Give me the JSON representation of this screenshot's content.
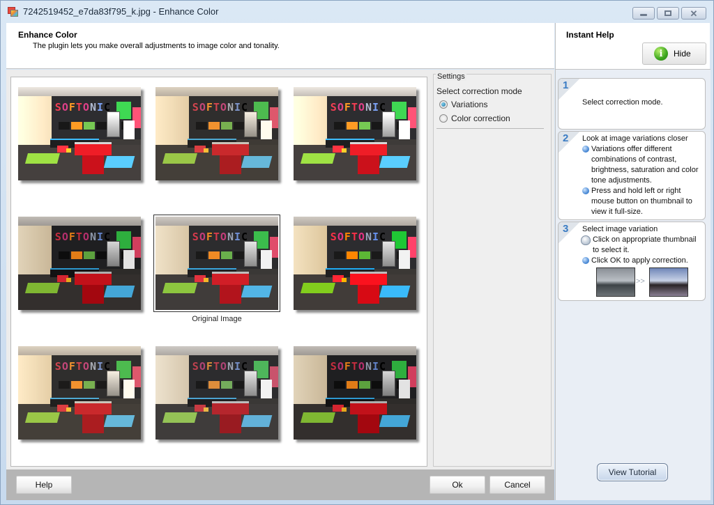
{
  "window": {
    "title": "7242519452_e7da83f795_k.jpg - Enhance Color",
    "buttons": [
      "minimize",
      "maximize",
      "close"
    ]
  },
  "header": {
    "title": "Enhance Color",
    "description": "The plugin lets you make overall adjustments to image color and tonality."
  },
  "thumbnails": {
    "scene_text": "SOFTONIC",
    "items": [
      {
        "label": "",
        "variant": "v-bright",
        "selected": false
      },
      {
        "label": "",
        "variant": "v-warm",
        "selected": false
      },
      {
        "label": "",
        "variant": "v-bright",
        "selected": false
      },
      {
        "label": "",
        "variant": "v-dark",
        "selected": false
      },
      {
        "label": "Original Image",
        "variant": "original",
        "selected": true
      },
      {
        "label": "",
        "variant": "v-sat",
        "selected": false
      },
      {
        "label": "",
        "variant": "v-warm",
        "selected": false
      },
      {
        "label": "",
        "variant": "v-desat",
        "selected": false
      },
      {
        "label": "",
        "variant": "v-dark",
        "selected": false
      }
    ]
  },
  "settings": {
    "legend": "Settings",
    "mode_label": "Select correction mode",
    "options": [
      {
        "label": "Variations",
        "checked": true
      },
      {
        "label": "Color correction",
        "checked": false
      }
    ]
  },
  "footer": {
    "help_label": "Help",
    "ok_label": "Ok",
    "cancel_label": "Cancel"
  },
  "help": {
    "title": "Instant Help",
    "hide_label": "Hide",
    "steps": [
      {
        "number": "1",
        "heading": "Select correction mode.",
        "bullets": []
      },
      {
        "number": "2",
        "heading": "Look at image variations closer",
        "bullets": [
          "Variations offer different combinations of contrast, brightness, saturation and color tone adjustments.",
          "Press and hold left or right mouse button on thumbnail to view  it full-size."
        ]
      },
      {
        "number": "3",
        "heading": "Select image variation",
        "bullets": [
          "Click on appropriate thumbnail to select it.",
          "Click OK to apply correction."
        ],
        "demo_arrow": ">>"
      }
    ],
    "tutorial_label": "View Tutorial"
  }
}
